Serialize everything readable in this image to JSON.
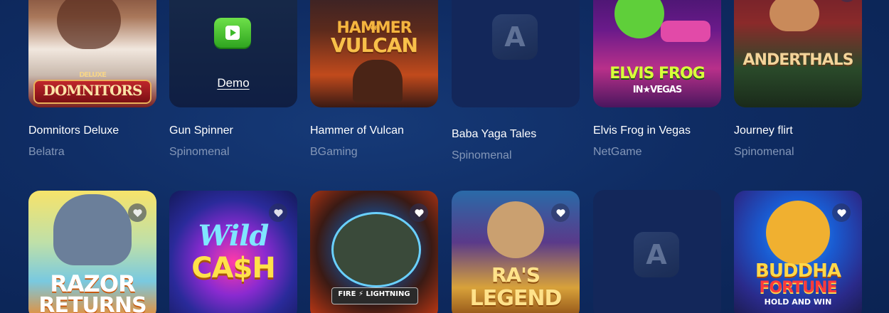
{
  "row1": [
    {
      "title": "Domnitors Deluxe",
      "provider": "Belatra",
      "art_line1": "DELUXE",
      "art_line2": "DOMNITORS"
    },
    {
      "title": "Gun Spinner",
      "provider": "Spinomenal",
      "demo_label": "Demo",
      "play_icon": "play-icon"
    },
    {
      "title": "Hammer of Vulcan",
      "provider": "BGaming",
      "art_line1": "HAMMER",
      "art_line2": "VULCAN",
      "art_small": "OF"
    },
    {
      "title": "Baba Yaga Tales",
      "provider": "Spinomenal",
      "placeholder_letter": "A"
    },
    {
      "title": "Elvis Frog in Vegas",
      "provider": "NetGame",
      "art_line1": "ELVIS FROG",
      "art_line2": "IN★VEGAS"
    },
    {
      "title": "Journey flirt",
      "provider": "Spinomenal",
      "art_line1": "ANDERTHALS"
    }
  ],
  "row2": [
    {
      "art_line1": "RAZOR",
      "art_line2": "RETURNS"
    },
    {
      "art_line1": "Wild",
      "art_line2": "CA$H"
    },
    {
      "art_line1": "FIRE ⚡ LIGHTNING"
    },
    {
      "art_line1": "RA'S",
      "art_line2": "LEGEND"
    },
    {
      "placeholder_letter": "A"
    },
    {
      "art_line1": "BUDDHA",
      "art_line2": "FORTUNE",
      "art_line3": "HOLD AND WIN"
    }
  ],
  "colors": {
    "background": "#0f2c63",
    "title": "#ffffff",
    "provider": "#8497b8",
    "placeholder": "#13275a"
  }
}
